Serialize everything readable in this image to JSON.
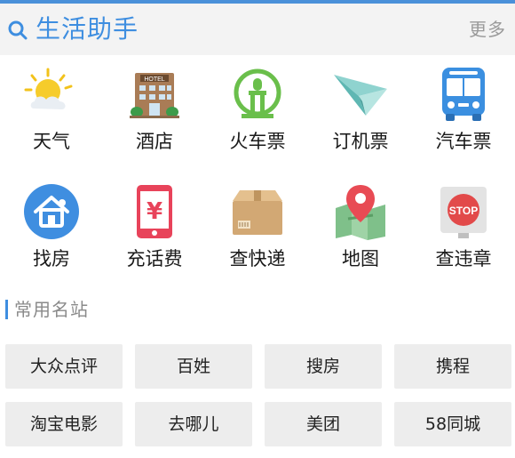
{
  "header": {
    "title": "生活助手",
    "more": "更多",
    "icon": "search-icon"
  },
  "tools": [
    {
      "label": "天气",
      "icon": "weather-icon"
    },
    {
      "label": "酒店",
      "icon": "hotel-icon"
    },
    {
      "label": "火车票",
      "icon": "train-icon"
    },
    {
      "label": "订机票",
      "icon": "paper-plane-icon"
    },
    {
      "label": "汽车票",
      "icon": "bus-icon"
    },
    {
      "label": "找房",
      "icon": "house-icon"
    },
    {
      "label": "充话费",
      "icon": "phone-yuan-icon"
    },
    {
      "label": "查快递",
      "icon": "package-icon"
    },
    {
      "label": "地图",
      "icon": "map-pin-icon"
    },
    {
      "label": "查违章",
      "icon": "stop-sign-icon"
    }
  ],
  "hotel_sign": "HOTEL",
  "stop_sign": "STOP",
  "section": {
    "title": "常用名站"
  },
  "sites": [
    "大众点评",
    "百姓",
    "搜房",
    "携程",
    "淘宝电影",
    "去哪儿",
    "美团",
    "58同城"
  ],
  "colors": {
    "accent": "#3e8ee0",
    "tile_bg": "#ededed",
    "header_bg": "#f3f3f3"
  }
}
